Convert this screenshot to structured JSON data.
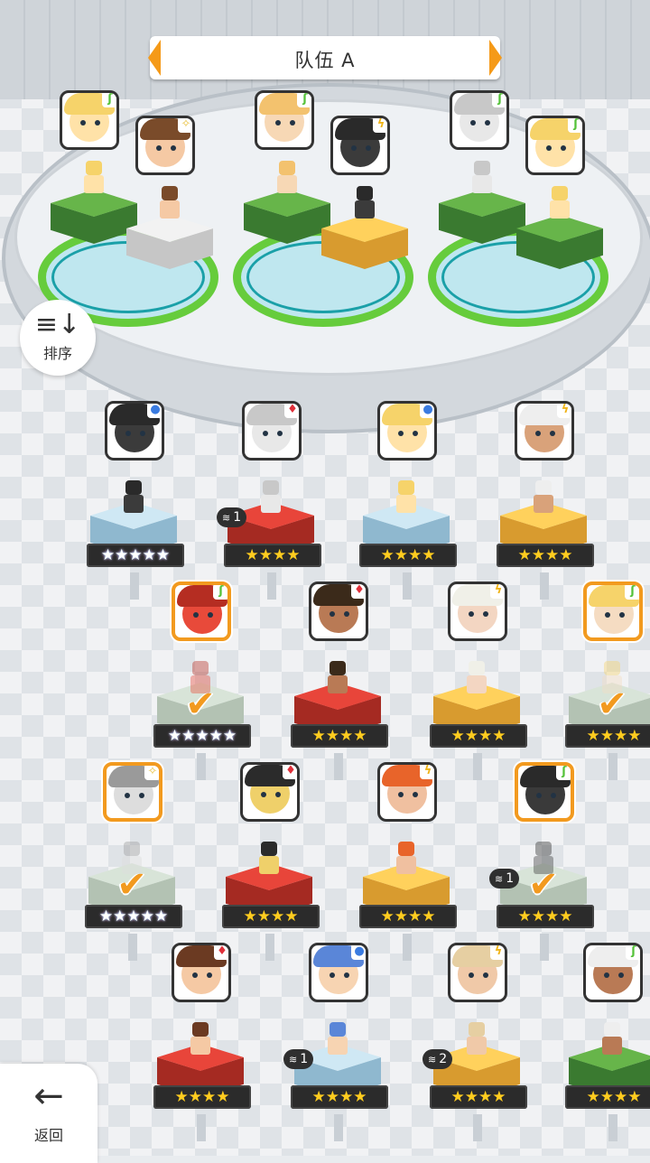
{
  "header": {
    "title": "队伍 A"
  },
  "side": {
    "sort_label": "排序",
    "sort_icon": "sort-icon",
    "back_label": "返回",
    "back_icon": "back-arrow-icon"
  },
  "colors": {
    "accent": "#f59a18",
    "ring": "#66cc3c",
    "selected": "#f29a1f"
  },
  "team_slots": [
    {
      "members": [
        {
          "element": "leaf"
        },
        {
          "element": "star"
        }
      ]
    },
    {
      "members": [
        {
          "element": "leaf"
        },
        {
          "element": "bolt"
        }
      ]
    },
    {
      "members": [
        {
          "element": "leaf"
        },
        {
          "element": "leaf"
        }
      ]
    }
  ],
  "roster": [
    {
      "element": "water",
      "stars": "★★★★★",
      "rainbow": true,
      "selected": false,
      "dup": ""
    },
    {
      "element": "fire",
      "stars": "★★★★",
      "rainbow": false,
      "selected": false,
      "dup": "1"
    },
    {
      "element": "water",
      "stars": "★★★★",
      "rainbow": false,
      "selected": false,
      "dup": ""
    },
    {
      "element": "bolt",
      "stars": "★★★★",
      "rainbow": false,
      "selected": false,
      "dup": ""
    },
    {
      "element": "leaf",
      "stars": "★★★★★",
      "rainbow": true,
      "selected": true,
      "dup": ""
    },
    {
      "element": "fire",
      "stars": "★★★★",
      "rainbow": false,
      "selected": false,
      "dup": ""
    },
    {
      "element": "bolt",
      "stars": "★★★★",
      "rainbow": false,
      "selected": false,
      "dup": ""
    },
    {
      "element": "leaf",
      "stars": "★★★★",
      "rainbow": false,
      "selected": true,
      "dup": ""
    },
    {
      "element": "star",
      "stars": "★★★★★",
      "rainbow": true,
      "selected": true,
      "dup": ""
    },
    {
      "element": "fire",
      "stars": "★★★★",
      "rainbow": false,
      "selected": false,
      "dup": ""
    },
    {
      "element": "bolt",
      "stars": "★★★★",
      "rainbow": false,
      "selected": false,
      "dup": ""
    },
    {
      "element": "leaf",
      "stars": "★★★★",
      "rainbow": false,
      "selected": true,
      "dup": "1"
    },
    {
      "element": "fire",
      "stars": "★★★★",
      "rainbow": false,
      "selected": false,
      "dup": ""
    },
    {
      "element": "water",
      "stars": "★★★★",
      "rainbow": false,
      "selected": false,
      "dup": "1"
    },
    {
      "element": "bolt",
      "stars": "★★★★",
      "rainbow": false,
      "selected": false,
      "dup": "2"
    },
    {
      "element": "leaf",
      "stars": "★★★★",
      "rainbow": false,
      "selected": false,
      "dup": ""
    }
  ]
}
